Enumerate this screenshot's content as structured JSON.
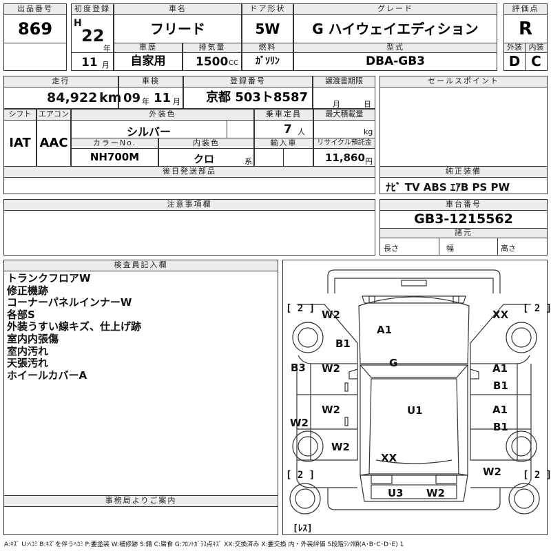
{
  "header": {
    "lot_label": "出品番号",
    "lot_value": "869",
    "first_reg_label": "初度登録",
    "era": "H",
    "year": "22",
    "year_unit": "年",
    "month": "11",
    "month_unit": "月",
    "car_name_label": "車名",
    "car_name": "フリード",
    "door_label": "ドア形状",
    "door": "5W",
    "grade_label": "グレード",
    "grade": "G ハイウェイエディション",
    "score_label": "評価点",
    "score": "R",
    "history_label": "車歴",
    "history": "自家用",
    "displacement_label": "排気量",
    "displacement": "1500",
    "displacement_unit": "CC",
    "fuel_label": "燃料",
    "fuel": "ｶﾞｿﾘﾝ",
    "model_label": "型式",
    "model": "DBA-GB3",
    "exterior_label": "外装",
    "exterior": "D",
    "interior_label": "内装",
    "interior": "C"
  },
  "row2": {
    "mileage_label": "走行",
    "mileage": "84,922",
    "mileage_unit": "km",
    "inspection_label": "車検",
    "insp_year": "09",
    "insp_year_unit": "年",
    "insp_month": "11",
    "insp_month_unit": "月",
    "reg_no_label": "登録番号",
    "reg_no": "京都 503ト8587",
    "transfer_label": "譲渡書期限",
    "transfer_month": "月",
    "transfer_day": "日",
    "sales_point_label": "セールスポイント"
  },
  "row3": {
    "shift_label": "シフト",
    "shift": "IAT",
    "aircon_label": "エアコン",
    "aircon": "AAC",
    "ext_color_label": "外装色",
    "ext_color": "シルバー",
    "capacity_label": "乗車定員",
    "capacity": "7",
    "capacity_unit": "人",
    "max_load_label": "最大積載量",
    "max_load_unit": "kg",
    "color_no_label": "カラーNo.",
    "color_no": "NH700M",
    "int_color_label": "内装色",
    "int_color": "クロ",
    "int_color_unit": "系",
    "import_label": "輸入車",
    "recycle_label": "リサイクル預託金",
    "recycle": "11,860",
    "recycle_unit": "円"
  },
  "later_parts_label": "後日発送部品",
  "equipment": {
    "label": "純正装備",
    "items": "ﾅﾋﾞ TV ABS ｴｱB PS PW"
  },
  "notes_label": "注意事項欄",
  "chassis": {
    "label": "車台番号",
    "value": "GB3-1215562",
    "dims_label": "諸元",
    "length_label": "長さ",
    "width_label": "幅",
    "height_label": "高さ"
  },
  "inspector": {
    "label": "検査員記入欄",
    "remarks": [
      "トランクフロアW",
      "修正機跡",
      "コーナーパネルインナーW",
      "各部S",
      "外装うすい線キズ、仕上げ跡",
      "室内内張傷",
      "室内汚れ",
      "天張汚れ",
      "ホイールカバーA"
    ]
  },
  "office_label": "事務局よりご案内",
  "diagram": {
    "tire_fl": "[ 2 ]",
    "tire_fr": "[ 2 ]",
    "tire_rl": "[ 2 ]",
    "tire_rr": "[ 2 ]",
    "spare": "[ﾚｽ]",
    "marks": {
      "m_w2_fl": "W2",
      "m_xx_fr": "XX",
      "m_a1_hood": "A1",
      "m_b1_l": "B1",
      "m_b3": "B3",
      "m_g": "G",
      "m_w2_ld1": "W2",
      "m_a1_rd1": "A1",
      "m_b1_rd1": "B1",
      "m_w2_ld2": "W2",
      "m_u1": "U1",
      "m_a1_rd2": "A1",
      "m_b1_rd2": "B1",
      "m_w2_lsill": "W2",
      "m_w2_rl": "W2",
      "m_xx_trunk": "XX",
      "m_w2_rr": "W2",
      "m_u3": "U3",
      "m_w2_rear": "W2"
    }
  },
  "legend": "A:ｷｽﾞ U:ﾍｺﾐ B:ｷｽﾞを伴うﾍｺﾐ P:要塗装 W:補修跡 S:錆 C:腐食 G:ﾌﾛﾝﾄｶﾞﾗｽ点ｷｽﾞ XX:交換済み X:要交換 内・外装評価 5段階ﾗﾝｸ順(A･B･C･D･E) 1",
  "colors": {
    "line": "#333333",
    "header_bg": "#ececec"
  }
}
